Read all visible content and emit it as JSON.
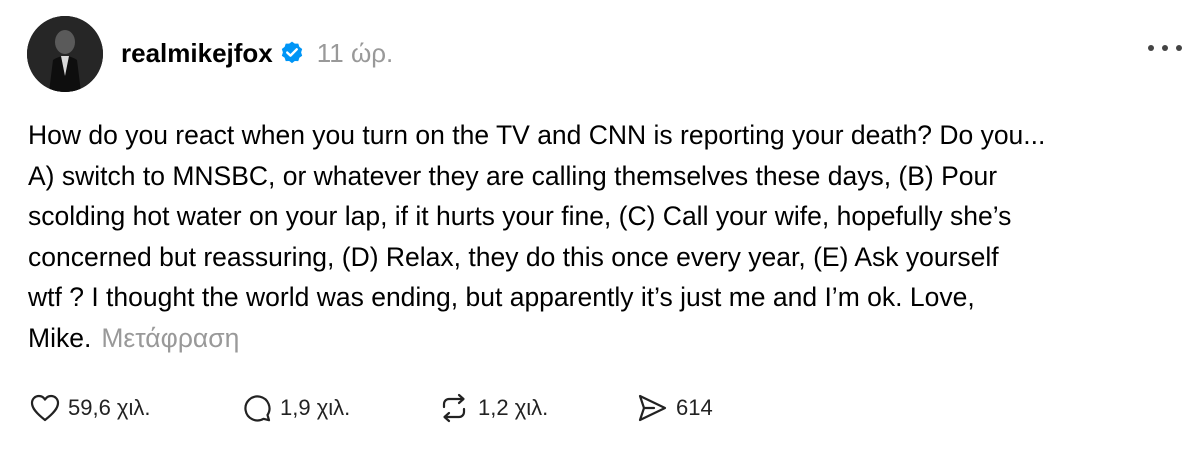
{
  "post": {
    "username": "realmikejfox",
    "timestamp": "11 ώρ.",
    "body_lines": [
      "How do you react when you turn on the TV and CNN is reporting your death? Do you...",
      "A) switch to MNSBC, or whatever they are calling themselves these days, (B) Pour",
      "scolding hot water on your lap, if it hurts your fine, (C) Call your wife, hopefully she’s",
      "concerned but reassuring, (D) Relax, they do this once every year, (E) Ask yourself",
      "wtf ? I thought the world was ending, but apparently it’s just me and I’m ok. Love,"
    ],
    "body_last": "Mike.",
    "translate_label": "Μετάφραση"
  },
  "actions": {
    "likes": "59,6 χιλ.",
    "replies": "1,9 χιλ.",
    "reposts": "1,2 χιλ.",
    "shares": "614"
  },
  "icons": {
    "verified": "verified-badge-icon",
    "more": "more-options-icon",
    "like": "heart-icon",
    "reply": "comment-bubble-icon",
    "repost": "repost-arrows-icon",
    "share": "send-icon"
  },
  "colors": {
    "verified_blue": "#0095f6",
    "muted_text": "#999999"
  }
}
